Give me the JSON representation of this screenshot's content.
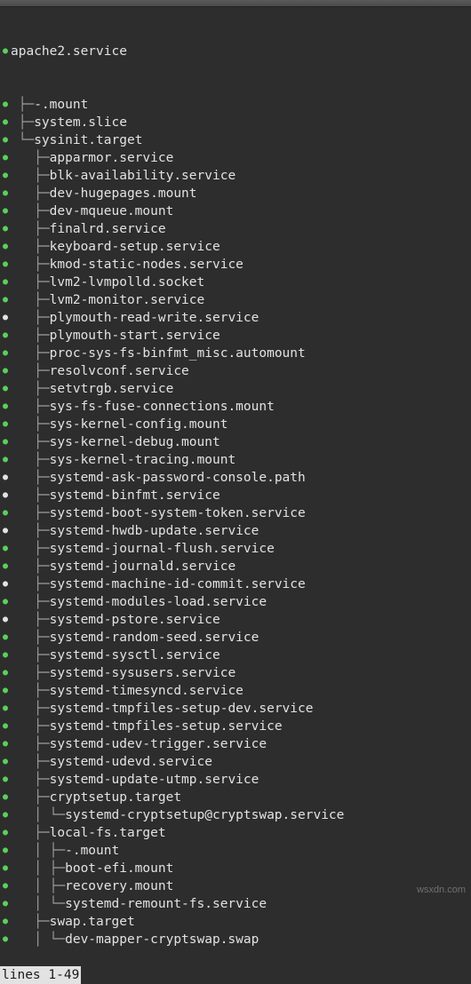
{
  "root": {
    "dot": "green",
    "prefix": "",
    "name": "apache2.service"
  },
  "rows": [
    {
      "dot": "green",
      "prefix": "├─",
      "name": "-.mount"
    },
    {
      "dot": "green",
      "prefix": "├─",
      "name": "system.slice"
    },
    {
      "dot": "green",
      "prefix": "└─",
      "name": "sysinit.target"
    },
    {
      "dot": "green",
      "prefix": "  ├─",
      "name": "apparmor.service"
    },
    {
      "dot": "green",
      "prefix": "  ├─",
      "name": "blk-availability.service"
    },
    {
      "dot": "green",
      "prefix": "  ├─",
      "name": "dev-hugepages.mount"
    },
    {
      "dot": "green",
      "prefix": "  ├─",
      "name": "dev-mqueue.mount"
    },
    {
      "dot": "green",
      "prefix": "  ├─",
      "name": "finalrd.service"
    },
    {
      "dot": "green",
      "prefix": "  ├─",
      "name": "keyboard-setup.service"
    },
    {
      "dot": "green",
      "prefix": "  ├─",
      "name": "kmod-static-nodes.service"
    },
    {
      "dot": "green",
      "prefix": "  ├─",
      "name": "lvm2-lvmpolld.socket"
    },
    {
      "dot": "green",
      "prefix": "  ├─",
      "name": "lvm2-monitor.service"
    },
    {
      "dot": "white",
      "prefix": "  ├─",
      "name": "plymouth-read-write.service"
    },
    {
      "dot": "green",
      "prefix": "  ├─",
      "name": "plymouth-start.service"
    },
    {
      "dot": "green",
      "prefix": "  ├─",
      "name": "proc-sys-fs-binfmt_misc.automount"
    },
    {
      "dot": "green",
      "prefix": "  ├─",
      "name": "resolvconf.service"
    },
    {
      "dot": "green",
      "prefix": "  ├─",
      "name": "setvtrgb.service"
    },
    {
      "dot": "green",
      "prefix": "  ├─",
      "name": "sys-fs-fuse-connections.mount"
    },
    {
      "dot": "green",
      "prefix": "  ├─",
      "name": "sys-kernel-config.mount"
    },
    {
      "dot": "green",
      "prefix": "  ├─",
      "name": "sys-kernel-debug.mount"
    },
    {
      "dot": "green",
      "prefix": "  ├─",
      "name": "sys-kernel-tracing.mount"
    },
    {
      "dot": "white",
      "prefix": "  ├─",
      "name": "systemd-ask-password-console.path"
    },
    {
      "dot": "white",
      "prefix": "  ├─",
      "name": "systemd-binfmt.service"
    },
    {
      "dot": "green",
      "prefix": "  ├─",
      "name": "systemd-boot-system-token.service"
    },
    {
      "dot": "white",
      "prefix": "  ├─",
      "name": "systemd-hwdb-update.service"
    },
    {
      "dot": "green",
      "prefix": "  ├─",
      "name": "systemd-journal-flush.service"
    },
    {
      "dot": "green",
      "prefix": "  ├─",
      "name": "systemd-journald.service"
    },
    {
      "dot": "white",
      "prefix": "  ├─",
      "name": "systemd-machine-id-commit.service"
    },
    {
      "dot": "green",
      "prefix": "  ├─",
      "name": "systemd-modules-load.service"
    },
    {
      "dot": "white",
      "prefix": "  ├─",
      "name": "systemd-pstore.service"
    },
    {
      "dot": "green",
      "prefix": "  ├─",
      "name": "systemd-random-seed.service"
    },
    {
      "dot": "green",
      "prefix": "  ├─",
      "name": "systemd-sysctl.service"
    },
    {
      "dot": "green",
      "prefix": "  ├─",
      "name": "systemd-sysusers.service"
    },
    {
      "dot": "green",
      "prefix": "  ├─",
      "name": "systemd-timesyncd.service"
    },
    {
      "dot": "green",
      "prefix": "  ├─",
      "name": "systemd-tmpfiles-setup-dev.service"
    },
    {
      "dot": "green",
      "prefix": "  ├─",
      "name": "systemd-tmpfiles-setup.service"
    },
    {
      "dot": "green",
      "prefix": "  ├─",
      "name": "systemd-udev-trigger.service"
    },
    {
      "dot": "green",
      "prefix": "  ├─",
      "name": "systemd-udevd.service"
    },
    {
      "dot": "green",
      "prefix": "  ├─",
      "name": "systemd-update-utmp.service"
    },
    {
      "dot": "green",
      "prefix": "  ├─",
      "name": "cryptsetup.target"
    },
    {
      "dot": "green",
      "prefix": "  │ └─",
      "name": "systemd-cryptsetup@cryptswap.service"
    },
    {
      "dot": "green",
      "prefix": "  ├─",
      "name": "local-fs.target"
    },
    {
      "dot": "green",
      "prefix": "  │ ├─",
      "name": "-.mount"
    },
    {
      "dot": "green",
      "prefix": "  │ ├─",
      "name": "boot-efi.mount"
    },
    {
      "dot": "green",
      "prefix": "  │ ├─",
      "name": "recovery.mount"
    },
    {
      "dot": "green",
      "prefix": "  │ └─",
      "name": "systemd-remount-fs.service"
    },
    {
      "dot": "green",
      "prefix": "  ├─",
      "name": "swap.target"
    },
    {
      "dot": "green",
      "prefix": "  │ └─",
      "name": "dev-mapper-cryptswap.swap"
    }
  ],
  "statusline": "lines 1-49",
  "watermark": "wsxdn.com"
}
